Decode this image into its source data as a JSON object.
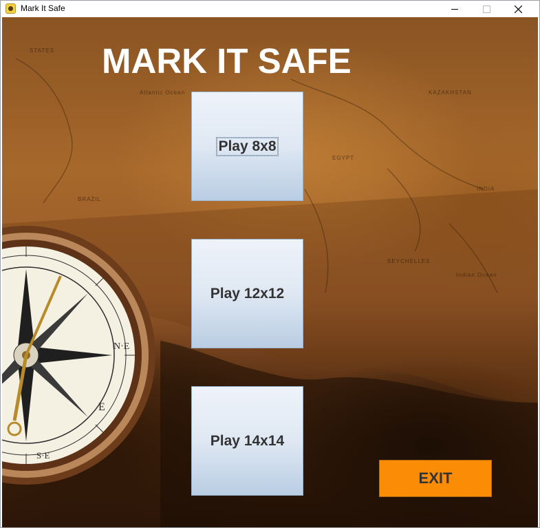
{
  "window": {
    "title": "Mark It Safe",
    "icon": "app-logo-icon"
  },
  "menu": {
    "title": "MARK IT SAFE",
    "buttons": [
      {
        "label": "Play 8x8",
        "focused": true
      },
      {
        "label": "Play 12x12",
        "focused": false
      },
      {
        "label": "Play 14x14",
        "focused": false
      }
    ],
    "exit_label": "EXIT"
  },
  "colors": {
    "exit_button": "#fb8c05",
    "play_button_top": "#eef3fa",
    "play_button_bottom": "#b9cde3",
    "title_text": "#ffffff",
    "button_text": "#333333"
  }
}
